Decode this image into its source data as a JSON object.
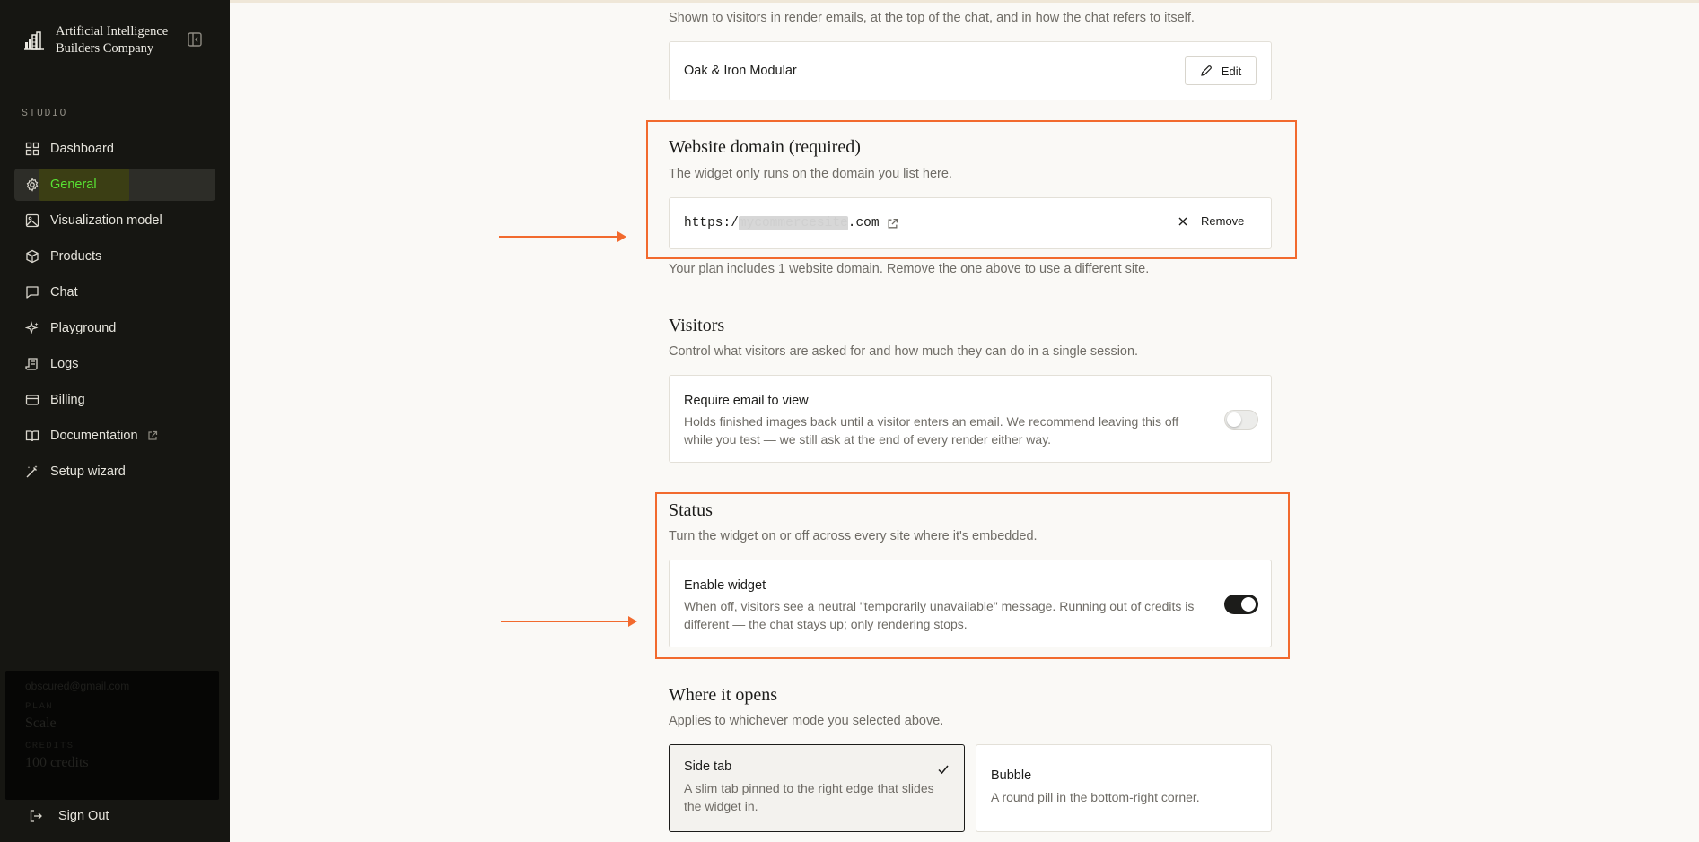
{
  "brand": {
    "name": "Artificial Intelligence Builders Company"
  },
  "sidebar": {
    "section_label": "STUDIO",
    "items": [
      {
        "label": "Dashboard",
        "icon": "dashboard-icon"
      },
      {
        "label": "General",
        "icon": "gear-icon",
        "active": true
      },
      {
        "label": "Visualization model",
        "icon": "image-icon"
      },
      {
        "label": "Products",
        "icon": "box-icon"
      },
      {
        "label": "Chat",
        "icon": "chat-icon"
      },
      {
        "label": "Playground",
        "icon": "sparkle-icon"
      },
      {
        "label": "Logs",
        "icon": "scroll-icon"
      },
      {
        "label": "Billing",
        "icon": "card-icon"
      },
      {
        "label": "Documentation",
        "icon": "book-icon"
      },
      {
        "label": "Setup wizard",
        "icon": "wand-icon"
      }
    ],
    "account": {
      "email": "obscured@gmail.com",
      "plan_label": "PLAN",
      "plan_value": "Scale",
      "credits_label": "CREDITS",
      "credits_value": "100 credits"
    },
    "sign_out": "Sign Out"
  },
  "name_section": {
    "description": "Shown to visitors in render emails, at the top of the chat, and in how the chat refers to itself.",
    "value": "Oak & Iron Modular",
    "edit_label": "Edit"
  },
  "domain_section": {
    "title": "Website domain (required)",
    "description": "The widget only runs on the domain you list here.",
    "url_prefix": "https:/",
    "url_hidden": "mycommercesite",
    "url_suffix": ".com",
    "remove_label": "Remove",
    "note": "Your plan includes 1 website domain. Remove the one above to use a different site."
  },
  "visitors_section": {
    "title": "Visitors",
    "description": "Control what visitors are asked for and how much they can do in a single session.",
    "setting_title": "Require email to view",
    "setting_desc": "Holds finished images back until a visitor enters an email. We recommend leaving this off while you test — we still ask at the end of every render either way.",
    "enabled": false
  },
  "status_section": {
    "title": "Status",
    "description": "Turn the widget on or off across every site where it's embedded.",
    "setting_title": "Enable widget",
    "setting_desc": "When off, visitors see a neutral \"temporarily unavailable\" message. Running out of credits is different — the chat stays up; only rendering stops.",
    "enabled": true
  },
  "open_section": {
    "title": "Where it opens",
    "description": "Applies to whichever mode you selected above.",
    "options": [
      {
        "title": "Side tab",
        "desc": "A slim tab pinned to the right edge that slides the widget in.",
        "selected": true
      },
      {
        "title": "Bubble",
        "desc": "A round pill in the bottom-right corner.",
        "selected": false
      }
    ]
  },
  "colors": {
    "accent_annotation": "#f26a2e",
    "sidebar_bg": "#161612",
    "active_text": "#58e233"
  }
}
